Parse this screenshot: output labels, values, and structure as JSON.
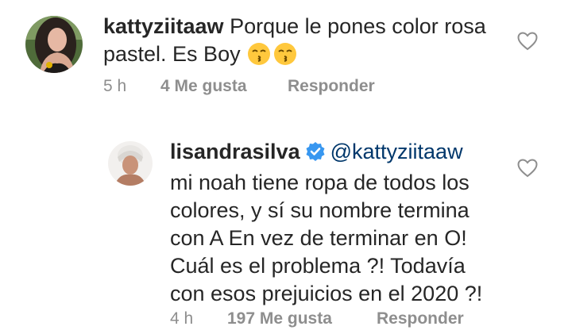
{
  "comments": [
    {
      "username": "kattyziitaaw",
      "text_line1": "Porque le pones color rosa",
      "text_line2": "pastel. Es Boy",
      "emojis": [
        "kissing-face-emoji",
        "kissing-face-emoji"
      ],
      "time": "5 h",
      "likes": "4 Me gusta",
      "reply": "Responder"
    },
    {
      "username": "lisandrasilva",
      "verified": true,
      "mention": "@kattyziitaaw",
      "lines": [
        "mi noah tiene ropa de todos los",
        "colores, y sí su nombre termina",
        "con A En vez de terminar en O!",
        "Cuál es el problema ?! Todavía",
        "con esos prejuicios en el 2020 ?!"
      ],
      "time": "4 h",
      "likes": "197 Me gusta",
      "reply": "Responder"
    }
  ],
  "colors": {
    "text": "#262626",
    "meta": "#8e8e8e",
    "mention": "#00376b",
    "verified": "#3897f0",
    "emoji": "#ffc83d"
  }
}
